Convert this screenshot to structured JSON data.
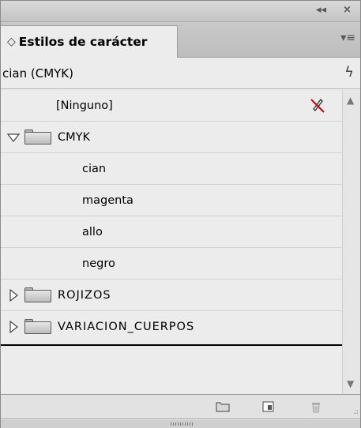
{
  "panel": {
    "tab_title": "Estilos de carácter",
    "tab_arrows": "◇",
    "collapse_label": "◂◂",
    "close_label": "×",
    "menu_label": "▾≡"
  },
  "current_style": {
    "label": "cian (CMYK)",
    "bolt": "ϟ"
  },
  "list": {
    "rows": [
      {
        "label": "[Ninguno]"
      },
      {
        "label": "CMYK"
      },
      {
        "label": "cian"
      },
      {
        "label": "magenta"
      },
      {
        "label": "allo"
      },
      {
        "label": "negro"
      },
      {
        "label": "ROJIZOS"
      },
      {
        "label": "VARIACION_CUERPOS"
      }
    ]
  },
  "colors": {
    "panel_bg": "#ececec",
    "none_icon": "#cc0000"
  },
  "icons": {
    "new_group": "folder-icon",
    "new_style": "new-style-icon",
    "delete": "trash-icon",
    "none_style": "pen-slash-icon"
  }
}
